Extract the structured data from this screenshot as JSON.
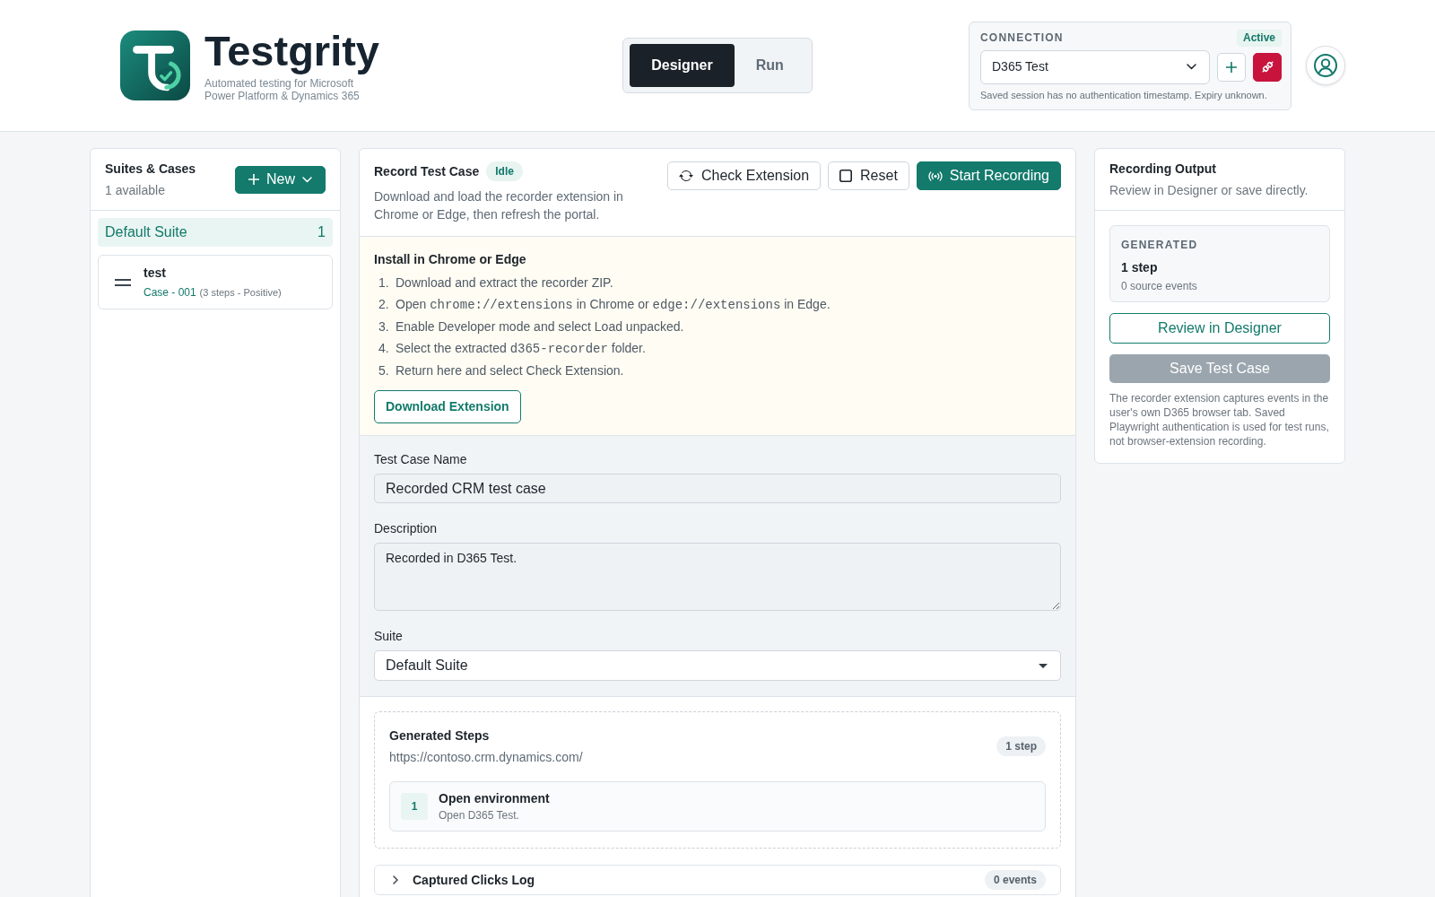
{
  "header": {
    "brand": {
      "name": "Testgrity",
      "tagline": "Automated testing for Microsoft Power Platform & Dynamics 365"
    },
    "mode_tabs": [
      {
        "label": "Designer",
        "selected": true
      },
      {
        "label": "Run",
        "selected": false
      }
    ],
    "connection": {
      "label": "CONNECTION",
      "status": "Active",
      "environment": "D365 Test",
      "note": "Saved session has no authentication timestamp. Expiry unknown."
    }
  },
  "suites_panel": {
    "title": "Suites & Cases",
    "subtitle": "1 available",
    "new_button": "New",
    "suites": [
      {
        "name": "Default Suite",
        "count": "1",
        "selected": true,
        "cases": [
          {
            "name": "test",
            "code": "Case - 001",
            "details": "(3 steps - Positive)"
          }
        ]
      }
    ]
  },
  "recorder": {
    "title": "Record Test Case",
    "status": "Idle",
    "description": "Download and load the recorder extension in Chrome or Edge, then refresh the portal.",
    "buttons": [
      {
        "label": "Check Extension",
        "kind": "outline"
      },
      {
        "label": "Reset",
        "kind": "outline"
      },
      {
        "label": "Start Recording",
        "kind": "primary"
      }
    ],
    "install": {
      "title": "Install in Chrome or Edge",
      "steps": [
        {
          "number": "1.",
          "parts": [
            {
              "kind": "text",
              "text": "Download and extract the recorder ZIP."
            }
          ]
        },
        {
          "number": "2.",
          "parts": [
            {
              "kind": "text",
              "text": "Open "
            },
            {
              "kind": "code",
              "text": "chrome://extensions"
            },
            {
              "kind": "text",
              "text": " in Chrome or "
            },
            {
              "kind": "code",
              "text": "edge://extensions"
            },
            {
              "kind": "text",
              "text": " in Edge."
            }
          ]
        },
        {
          "number": "3.",
          "parts": [
            {
              "kind": "text",
              "text": "Enable Developer mode and select Load unpacked."
            }
          ]
        },
        {
          "number": "4.",
          "parts": [
            {
              "kind": "text",
              "text": "Select the extracted "
            },
            {
              "kind": "code",
              "text": "d365-recorder"
            },
            {
              "kind": "text",
              "text": " folder."
            }
          ]
        },
        {
          "number": "5.",
          "parts": [
            {
              "kind": "text",
              "text": "Return here and select Check Extension."
            }
          ]
        }
      ],
      "download_button": "Download Extension"
    },
    "form": {
      "name_label": "Test Case Name",
      "name_value": "Recorded CRM test case",
      "description_label": "Description",
      "description_value": "Recorded in D365 Test.",
      "suite_label": "Suite",
      "suite_value": "Default Suite"
    },
    "generated_steps": {
      "title": "Generated Steps",
      "url": "https://contoso.crm.dynamics.com/",
      "count": "1 step",
      "steps": [
        {
          "number": "1",
          "title": "Open environment",
          "detail": "Open D365 Test."
        }
      ]
    },
    "captured_clicks": {
      "title": "Captured Clicks Log",
      "count": "0 events",
      "expanded": false
    }
  },
  "output_panel": {
    "title": "Recording Output",
    "subtitle": "Review in Designer or save directly.",
    "summary": {
      "label": "GENERATED",
      "steps": "1 step",
      "events": "0 source events"
    },
    "review_button": "Review in Designer",
    "save_button": {
      "label": "Save Test Case",
      "disabled": true
    },
    "note": "The recorder extension captures events in the user's own D365 browser tab. Saved Playwright authentication is used for test runs, not browser-extension recording."
  }
}
